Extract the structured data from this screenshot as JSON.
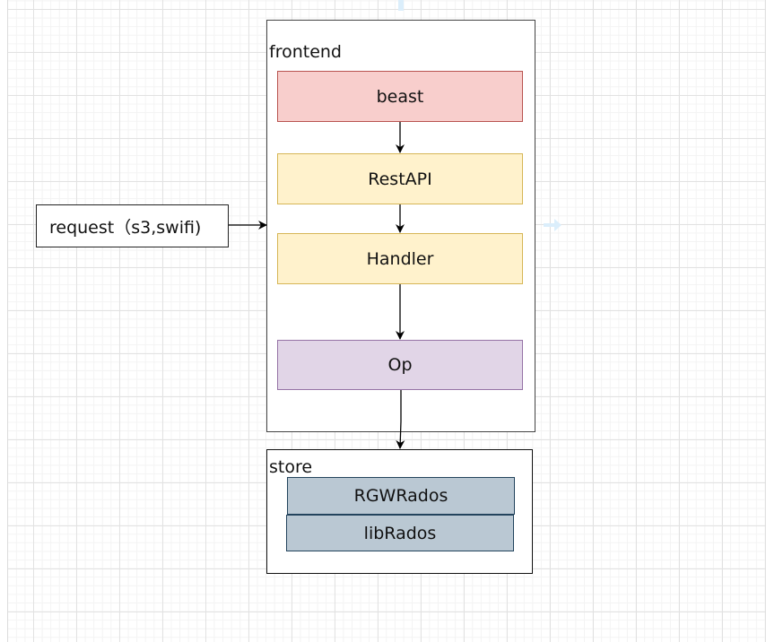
{
  "diagram": {
    "request": {
      "label": "request（s3,swifi)"
    },
    "frontend": {
      "label": "frontend",
      "nodes": [
        {
          "label": "beast",
          "fill": "#f8cecc",
          "stroke": "#b85450"
        },
        {
          "label": "RestAPI",
          "fill": "#fff2cc",
          "stroke": "#d6b656"
        },
        {
          "label": "Handler",
          "fill": "#fff2cc",
          "stroke": "#d6b656"
        },
        {
          "label": "Op",
          "fill": "#e1d5e7",
          "stroke": "#9673a6"
        }
      ]
    },
    "store": {
      "label": "store",
      "nodes": [
        {
          "label": "RGWRados",
          "fill": "#bac8d3",
          "stroke": "#23445d"
        },
        {
          "label": "libRados",
          "fill": "#bac8d3",
          "stroke": "#23445d"
        }
      ]
    },
    "edges": [
      {
        "from": "request",
        "to": "frontend"
      },
      {
        "from": "beast",
        "to": "RestAPI"
      },
      {
        "from": "RestAPI",
        "to": "Handler"
      },
      {
        "from": "Handler",
        "to": "Op"
      },
      {
        "from": "Op",
        "to": "store"
      }
    ]
  }
}
